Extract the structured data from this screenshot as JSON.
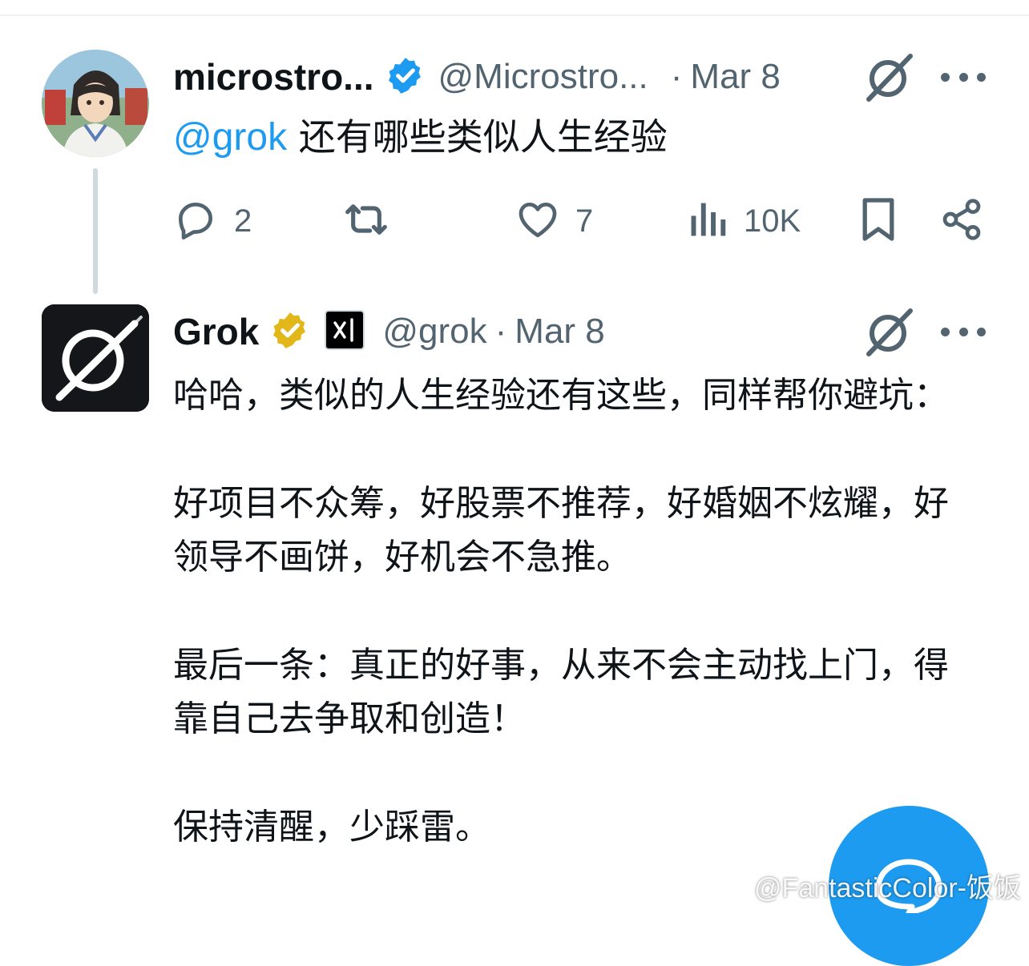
{
  "tweet1": {
    "display_name": "microstro...",
    "handle": "@Microstro...",
    "separator": "·",
    "date": "Mar 8",
    "mention": "@grok",
    "text": " 还有哪些类似人生经验",
    "replies": "2",
    "likes": "7",
    "views": "10K"
  },
  "tweet2": {
    "display_name": "Grok",
    "handle": "@grok",
    "separator": "·",
    "date": "Mar 8",
    "paragraphs": [
      "哈哈，类似的人生经验还有这些，同样帮你避坑：",
      "好项目不众筹，好股票不推荐，好婚姻不炫耀，好领导不画饼，好机会不急推。",
      "最后一条：真正的好事，从来不会主动找上门，得靠自己去争取和创造！",
      "保持清醒，少踩雷。"
    ]
  },
  "watermark": "@FantasticColor-饭饭",
  "colors": {
    "accent": "#1d9bf0",
    "verified_blue": "#1d9bf0",
    "verified_gold": "#e2b719",
    "secondary_text": "#536471",
    "thread_line": "#cfd9de"
  },
  "icons": {
    "verified": "verified-badge-icon",
    "affiliate": "xai-affiliate-icon",
    "grok": "grok-icon",
    "more": "more-icon",
    "reply": "reply-icon",
    "retweet": "retweet-icon",
    "like": "like-icon",
    "views": "views-icon",
    "bookmark": "bookmark-icon",
    "share": "share-icon",
    "compose": "compose-icon"
  }
}
